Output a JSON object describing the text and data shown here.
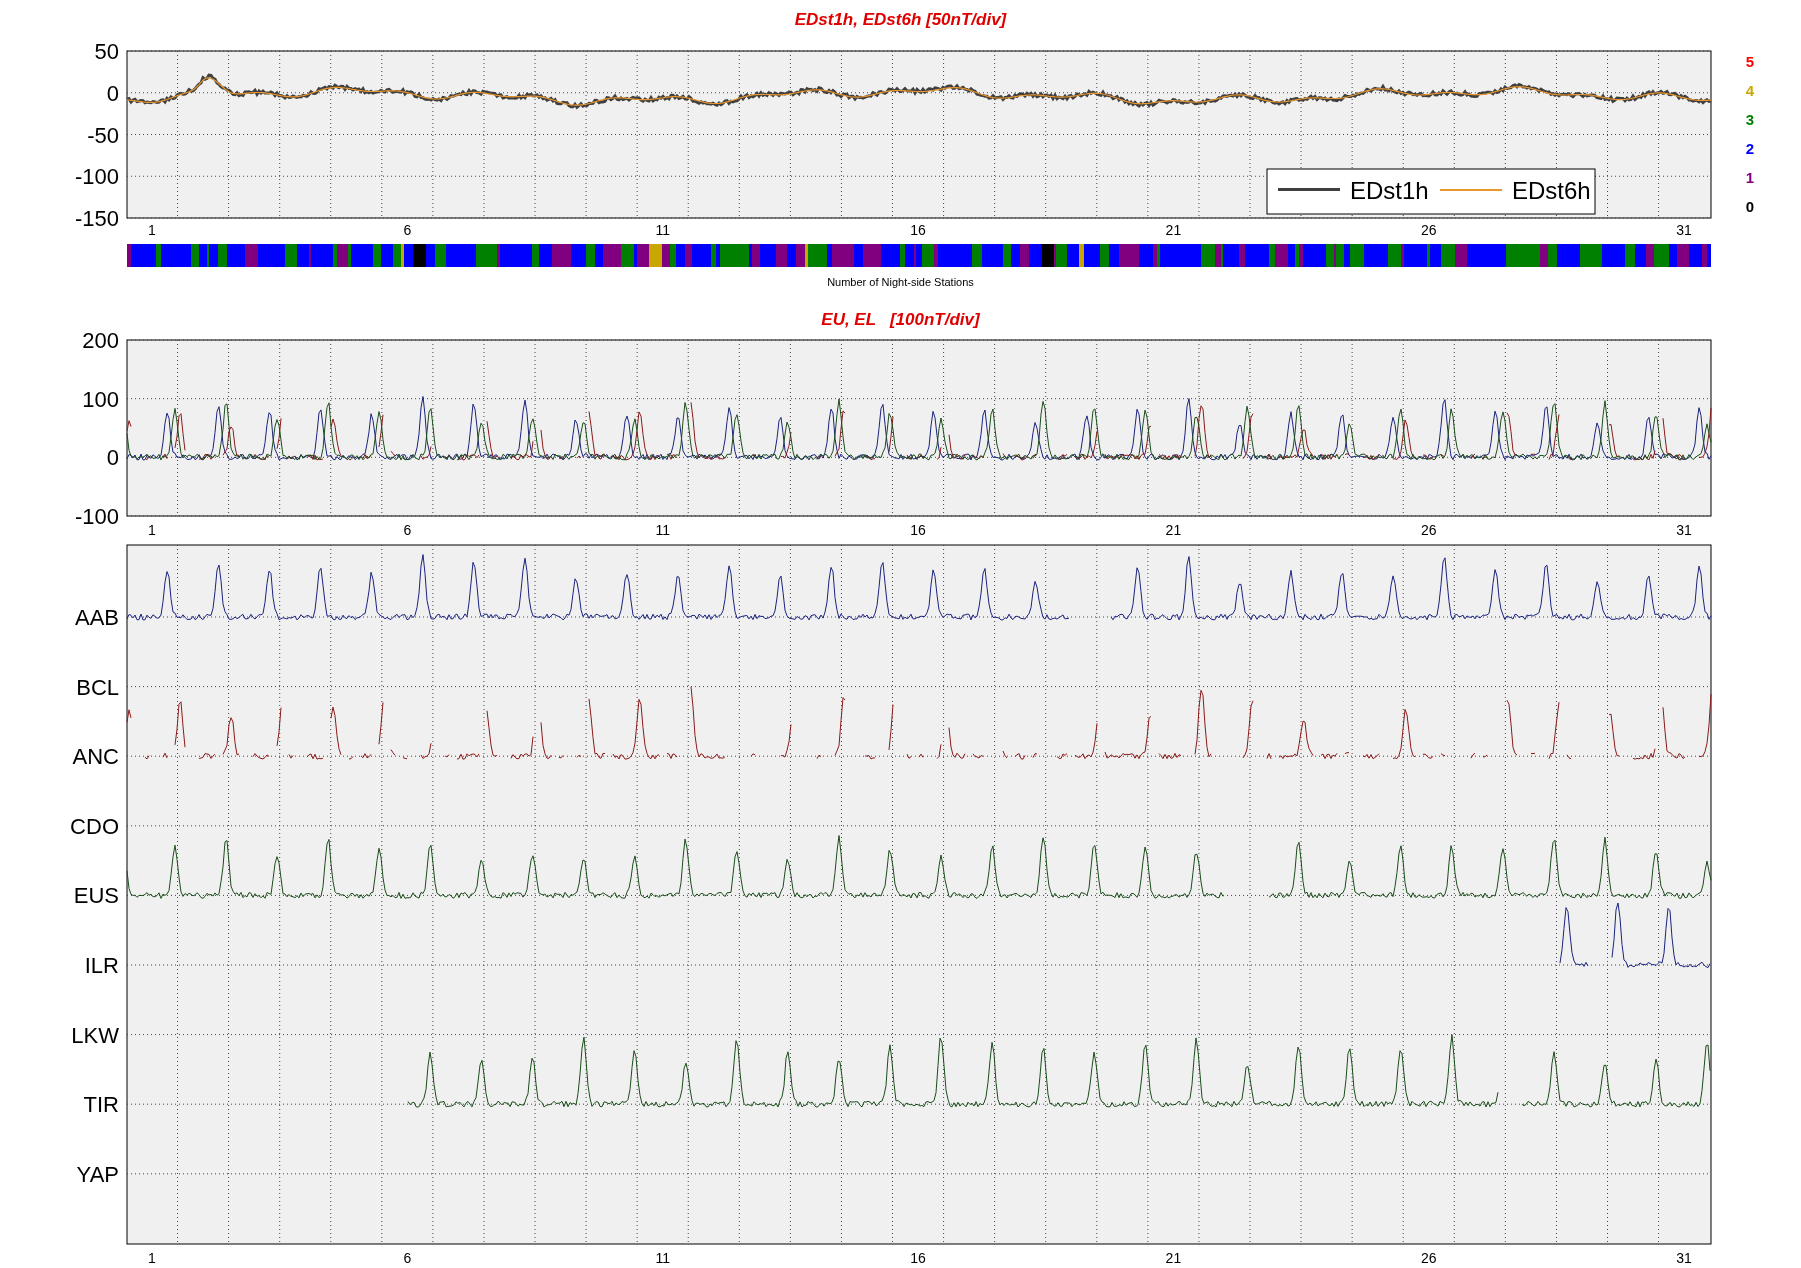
{
  "index_panel": {
    "title": "EDst1h, EDst6h [50nT/div]",
    "yticks": [
      "50",
      "0",
      "-50",
      "-100",
      "-150"
    ],
    "xticks": [
      "1",
      "6",
      "11",
      "16",
      "21",
      "26",
      "31"
    ],
    "legend": [
      {
        "label": "EDst1h",
        "color": "#404040"
      },
      {
        "label": "EDst6h",
        "color": "#e8962e"
      }
    ]
  },
  "station_scale": [
    {
      "label": "5",
      "color": "#ff0000"
    },
    {
      "label": "4",
      "color": "#c8a800"
    },
    {
      "label": "3",
      "color": "#008000"
    },
    {
      "label": "2",
      "color": "#0000ff"
    },
    {
      "label": "1",
      "color": "#800080"
    },
    {
      "label": "0",
      "color": "#000000"
    }
  ],
  "station_bar": {
    "caption": "Number of Night-side Stations"
  },
  "electrojet_panel": {
    "title": "EU, EL   [100nT/div]",
    "yticks": [
      "200",
      "100",
      "0",
      "-100"
    ],
    "xticks": [
      "1",
      "6",
      "11",
      "16",
      "21",
      "26",
      "31"
    ]
  },
  "station_panel": {
    "stations": [
      "AAB",
      "BCL",
      "ANC",
      "CDO",
      "EUS",
      "ILR",
      "LKW",
      "TIR",
      "YAP"
    ],
    "xticks": [
      "1",
      "6",
      "11",
      "16",
      "21",
      "26",
      "31"
    ]
  }
}
